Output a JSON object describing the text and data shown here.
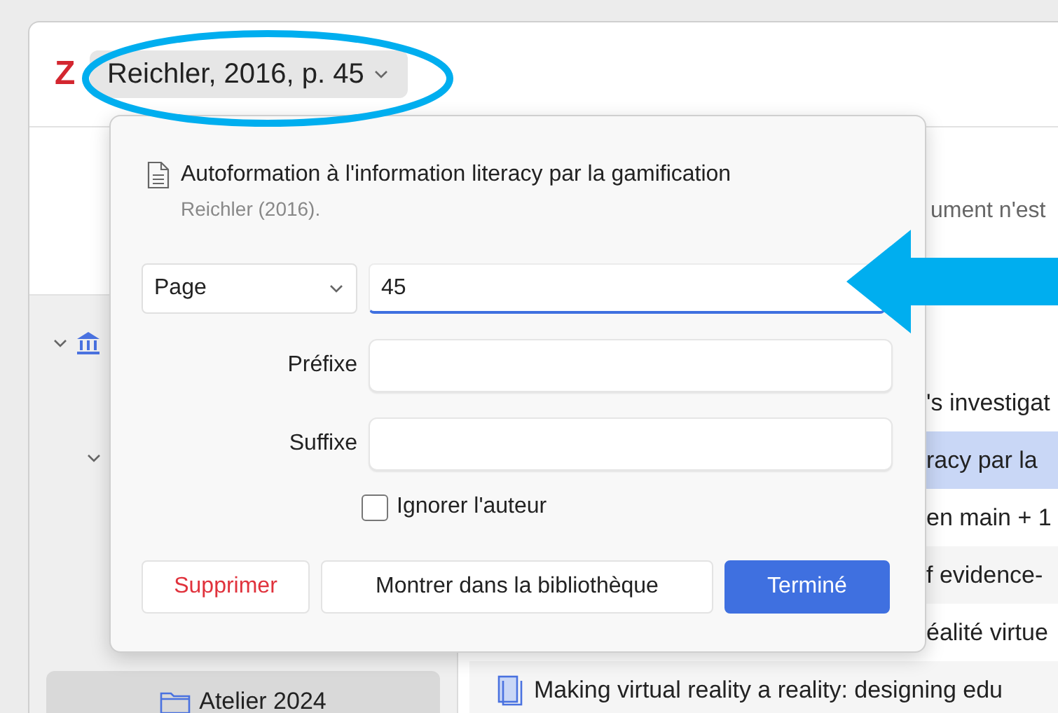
{
  "toolbar": {
    "logo": "Z",
    "citation": "Reichler, 2016, p. 45"
  },
  "background_text": "ument n'est",
  "tree": [
    {
      "expanded": true,
      "children": [
        {
          "expanded": true
        }
      ]
    }
  ],
  "collections": [
    {
      "label": "Atelier 2024",
      "selected": true
    }
  ],
  "items": [
    {
      "title": "'s investigat",
      "selected": false,
      "kind": "partial"
    },
    {
      "title": "racy par la",
      "selected": true,
      "kind": "partial"
    },
    {
      "title": "en main + 1",
      "selected": false,
      "kind": "partial"
    },
    {
      "title": "f evidence-",
      "selected": false,
      "kind": "partial"
    },
    {
      "title": "éalité virtue",
      "selected": false,
      "kind": "partial"
    },
    {
      "title": "Making virtual reality a reality: designing edu",
      "selected": false,
      "kind": "full"
    }
  ],
  "popup": {
    "title": "Autoformation à l'information literacy par la gamification",
    "subtitle": "Reichler (2016).",
    "locator": {
      "label": "Page",
      "value": "45"
    },
    "fields": [
      {
        "label": "Préfixe"
      },
      {
        "label": "Suffixe"
      }
    ],
    "checkbox": {
      "label": "Ignorer l'auteur",
      "checked": false
    },
    "buttons": [
      {
        "label": "Supprimer",
        "kind": "danger"
      },
      {
        "label": "Montrer dans la bibliothèque",
        "kind": "default"
      },
      {
        "label": "Terminé",
        "kind": "primary"
      }
    ]
  }
}
